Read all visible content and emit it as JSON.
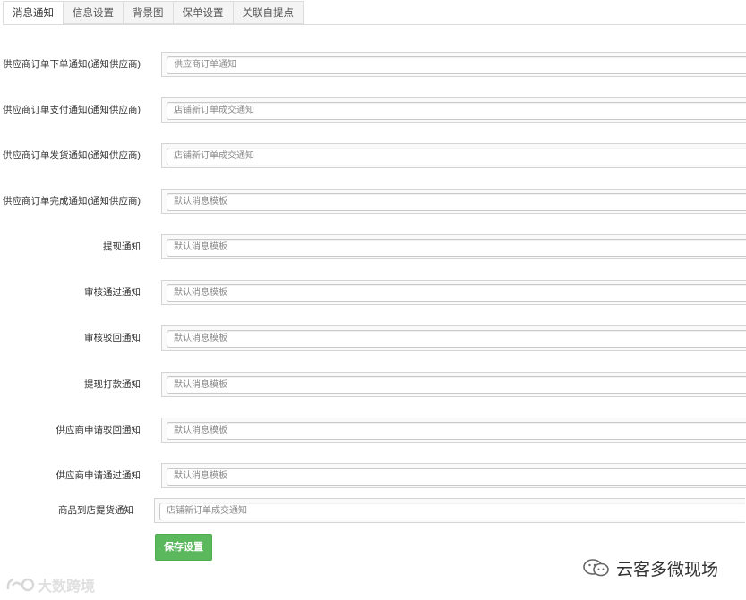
{
  "tabs": [
    {
      "label": "消息通知",
      "active": true
    },
    {
      "label": "信息设置",
      "active": false
    },
    {
      "label": "背景图",
      "active": false
    },
    {
      "label": "保单设置",
      "active": false
    },
    {
      "label": "关联自提点",
      "active": false
    }
  ],
  "fields": [
    {
      "label": "供应商订单下单通知(通知供应商)",
      "value": "供应商订单通知"
    },
    {
      "label": "供应商订单支付通知(通知供应商)",
      "value": "店铺新订单成交通知"
    },
    {
      "label": "供应商订单发货通知(通知供应商)",
      "value": "店铺新订单成交通知"
    },
    {
      "label": "供应商订单完成通知(通知供应商)",
      "value": "默认消息模板"
    },
    {
      "label": "提现通知",
      "value": "默认消息模板"
    },
    {
      "label": "审核通过通知",
      "value": "默认消息模板"
    },
    {
      "label": "审核驳回通知",
      "value": "默认消息模板"
    },
    {
      "label": "提现打款通知",
      "value": "默认消息模板"
    },
    {
      "label": "供应商申请驳回通知",
      "value": "默认消息模板"
    },
    {
      "label": "供应商申请通过通知",
      "value": "默认消息模板"
    },
    {
      "label": "商品到店提货通知",
      "value": "店铺新订单成交通知"
    }
  ],
  "save_button": "保存设置",
  "watermark_left": "大数跨境",
  "watermark_right": "云客多微现场",
  "colors": {
    "accent_green": "#5cb85c"
  }
}
